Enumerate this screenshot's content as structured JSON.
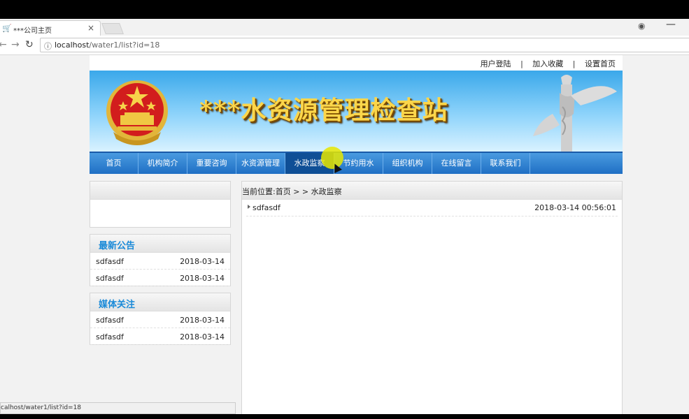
{
  "browser": {
    "tab_title": "***公司主页",
    "tab_close": "×",
    "url_host": "localhost",
    "url_path": "/water1/list?id=18",
    "status_url": "calhost/water1/list?id=18"
  },
  "topbar": {
    "login": "用户登陆",
    "favorite": "加入收藏",
    "homepage": "设置首页",
    "separator": "|"
  },
  "banner": {
    "title": "***水资源管理检查站"
  },
  "nav": {
    "items": [
      "首页",
      "机构简介",
      "重要咨询",
      "水资源管理",
      "水政监察",
      "节约用水",
      "组织机构",
      "在线留言",
      "联系我们"
    ],
    "active": "水政监察"
  },
  "left": {
    "notice_title": "最新公告",
    "notice_items": [
      {
        "title": "sdfasdf",
        "date": "2018-03-14"
      },
      {
        "title": "sdfasdf",
        "date": "2018-03-14"
      }
    ],
    "media_title": "媒体关注",
    "media_items": [
      {
        "title": "sdfasdf",
        "date": "2018-03-14"
      },
      {
        "title": "sdfasdf",
        "date": "2018-03-14"
      }
    ]
  },
  "main": {
    "breadcrumb": "当前位置:首页 > > 水政监察",
    "items": [
      {
        "title": "sdfasdf",
        "datetime": "2018-03-14 00:56:01"
      }
    ]
  },
  "colors": {
    "nav_blue": "#1f6fc4",
    "accent_title": "#1a8ad8",
    "banner_gold": "#fcd64a"
  }
}
